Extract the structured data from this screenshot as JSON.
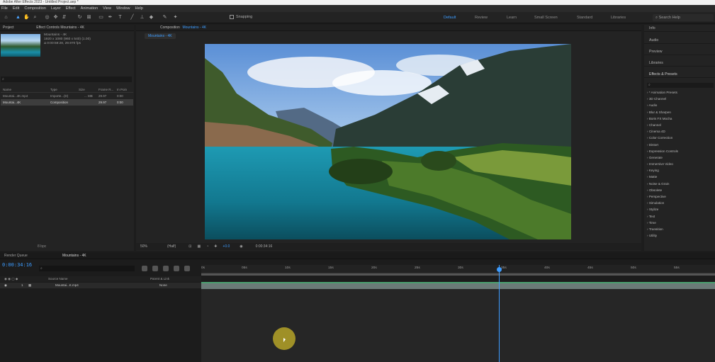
{
  "title_bar": "Adobe After Effects 2023 - Untitled Project.aep *",
  "menu": [
    "File",
    "Edit",
    "Composition",
    "Layer",
    "Effect",
    "Animation",
    "View",
    "Window",
    "Help"
  ],
  "toolbar": {
    "snapping_label": "Snapping",
    "workspaces": [
      "Default",
      "Review",
      "Learn",
      "Small Screen",
      "Standard",
      "Libraries"
    ],
    "active_workspace": "Default",
    "search_help_placeholder": "Search Help"
  },
  "project_panel": {
    "tab_project": "Project",
    "tab_effect_controls": "Effect Controls Mountains - 4K",
    "item_name": "Mountains - 4K",
    "item_info_1": "1920 x 1080 (960 x 540) (1.00)",
    "item_info_2": "Δ 0:00:59:28, 29.970 fps",
    "search_placeholder": "",
    "columns": [
      "Name",
      "Type",
      "Size",
      "Frame R...",
      "In Poin"
    ],
    "rows": [
      {
        "name": "Mountai...4K.mp4",
        "type": "Importe...(D)",
        "size": "... MB",
        "frame": "29.97",
        "in": "0:00"
      },
      {
        "name": "Mountai...4K",
        "type": "Composition",
        "size": "",
        "frame": "29.97",
        "in": "0:00"
      }
    ],
    "footer_depth": "8 bpc"
  },
  "comp_panel": {
    "header_label": "Composition",
    "header_comp": "Mountains - 4K",
    "tab_label": "Mountains - 4K",
    "zoom": "50%",
    "resolution": "(Half)",
    "exposure": "+0.0",
    "timecode": "0:00:34:16"
  },
  "effects_panel": {
    "sections": [
      "Info",
      "Audio",
      "Preview",
      "Libraries",
      "Effects & Presets"
    ],
    "search_placeholder": "",
    "items": [
      "* Animation Presets",
      "3D Channel",
      "Audio",
      "Blur & Sharpen",
      "Boris FX Mocha",
      "Channel",
      "Cinema 4D",
      "Color Correction",
      "Distort",
      "Expression Controls",
      "Generate",
      "Immersive Video",
      "Keying",
      "Matte",
      "Noise & Grain",
      "Obsolete",
      "Perspective",
      "Simulation",
      "Stylize",
      "Text",
      "Time",
      "Transition",
      "Utility"
    ]
  },
  "timeline": {
    "tab_render_queue": "Render Queue",
    "tab_comp": "Mountains - 4K",
    "timecode": "0:00:34:16",
    "col_source_name": "Source Name",
    "col_parent": "Parent & Link",
    "layer_index": "1",
    "layer_name": "Mountai...K.mp4",
    "layer_parent": "None",
    "ruler_ticks": [
      "0s",
      "05s",
      "10s",
      "15s",
      "20s",
      "25s",
      "30s",
      "35s",
      "40s",
      "45s",
      "50s",
      "55s"
    ]
  },
  "colors": {
    "accent_blue": "#3d9cff",
    "panel_bg": "#232323",
    "track_green": "#4aa070"
  }
}
